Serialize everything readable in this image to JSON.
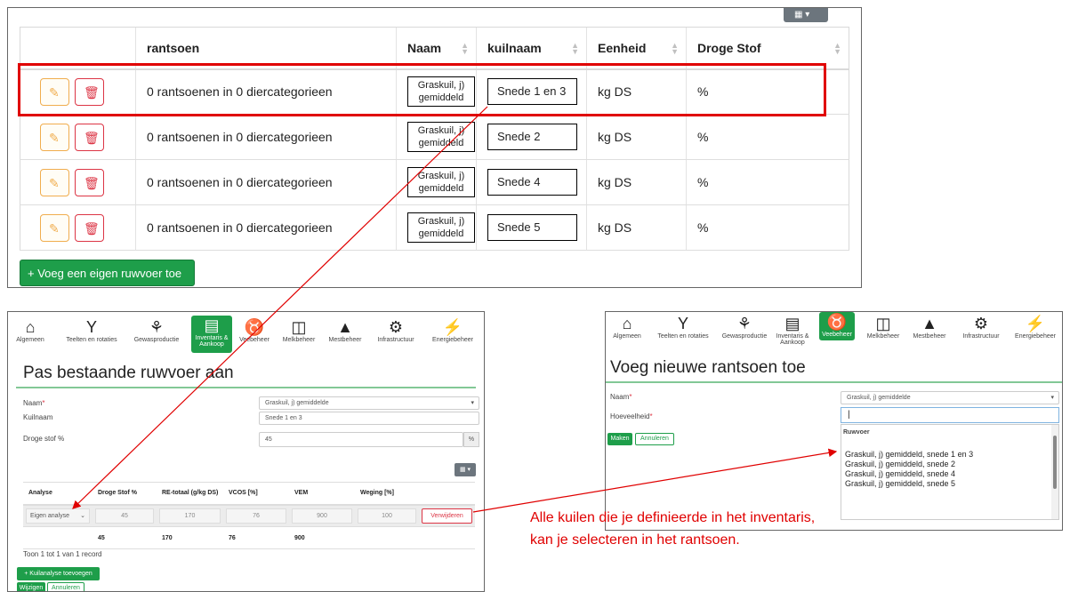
{
  "top_table": {
    "headers": [
      "",
      "rantsoen",
      "Naam",
      "kuilnaam",
      "Eenheid",
      "Droge Stof"
    ],
    "rows": [
      {
        "rantsoen": "0 rantsoenen in 0 diercategorieen",
        "naam": "Graskuil, j) gemiddeld",
        "kuilnaam": "Snede 1 en 3",
        "eenheid": "kg DS",
        "droge_stof": "%"
      },
      {
        "rantsoen": "0 rantsoenen in 0 diercategorieen",
        "naam": "Graskuil, j) gemiddeld",
        "kuilnaam": "Snede 2",
        "eenheid": "kg DS",
        "droge_stof": "%"
      },
      {
        "rantsoen": "0 rantsoenen in 0 diercategorieen",
        "naam": "Graskuil, j) gemiddeld",
        "kuilnaam": "Snede 4",
        "eenheid": "kg DS",
        "droge_stof": "%"
      },
      {
        "rantsoen": "0 rantsoenen in 0 diercategorieen",
        "naam": "Graskuil, j) gemiddeld",
        "kuilnaam": "Snede 5",
        "eenheid": "kg DS",
        "droge_stof": "%"
      }
    ],
    "add_button": "+ Voeg een eigen ruwvoer toe"
  },
  "nav": {
    "items": [
      {
        "label": "Algemeen",
        "icon": "home-icon",
        "glyph": "⌂"
      },
      {
        "label": "Teelten en rotaties",
        "icon": "sprout-icon",
        "glyph": "Y"
      },
      {
        "label": "Gewasproductie",
        "icon": "wheat-icon",
        "glyph": "⚘"
      },
      {
        "label": "Inventaris & Aankoop",
        "icon": "scale-icon",
        "glyph": "▤"
      },
      {
        "label": "Veebeheer",
        "icon": "cow-icon",
        "glyph": "♉"
      },
      {
        "label": "Melkbeheer",
        "icon": "milk-tank-icon",
        "glyph": "◫"
      },
      {
        "label": "Mestbeheer",
        "icon": "manure-icon",
        "glyph": "▲"
      },
      {
        "label": "Infrastructuur",
        "icon": "tractor-icon",
        "glyph": "⚙"
      },
      {
        "label": "Energiebeheer",
        "icon": "energy-icon",
        "glyph": "⚡"
      }
    ]
  },
  "left_form": {
    "title": "Pas bestaande ruwvoer aan",
    "naam_label": "Naam",
    "naam_value": "Graskuil, j) gemiddelde",
    "kuilnaam_label": "Kuilnaam",
    "kuilnaam_value": "Snede 1 en 3",
    "droge_stof_label": "Droge stof %",
    "droge_stof_value": "45",
    "droge_stof_unit": "%",
    "analysis_headers": [
      "Analyse",
      "Droge Stof %",
      "RE-totaal (g/kg DS)",
      "VCOS [%]",
      "VEM",
      "Weging [%]",
      ""
    ],
    "analysis_row": {
      "analyse": "Eigen analyse",
      "droge_stof": "45",
      "re_totaal": "170",
      "vcos": "76",
      "vem": "900",
      "weging": "100",
      "delete": "Verwijderen"
    },
    "totals": {
      "droge_stof": "45",
      "re_totaal": "170",
      "vcos": "76",
      "vem": "900"
    },
    "record_info": "Toon 1 tot 1 van 1 record",
    "add_analysis": "+ Kuilanalyse toevoegen",
    "save": "Wijzigen",
    "cancel": "Annuleren"
  },
  "right_form": {
    "title": "Voeg nieuwe rantsoen toe",
    "naam_label": "Naam",
    "naam_value": "Graskuil, j) gemiddelde",
    "hoeveelheid_label": "Hoeveelheid",
    "dropdown_header": "Ruwvoer",
    "options": [
      "Graskuil, j) gemiddeld, snede 1 en 3",
      "Graskuil, j) gemiddeld, snede 2",
      "Graskuil, j) gemiddeld, snede 4",
      "Graskuil, j) gemiddeld, snede 5"
    ],
    "make": "Maken",
    "cancel": "Annuleren"
  },
  "annotation": "Alle kuilen die je definieerde in het inventaris, kan je selecteren in het rantsoen.",
  "colors": {
    "accent_green": "#1e9e4a",
    "annotation_red": "#e00000",
    "edit_yellow": "#f0ad4e",
    "delete_red": "#dc3545"
  }
}
